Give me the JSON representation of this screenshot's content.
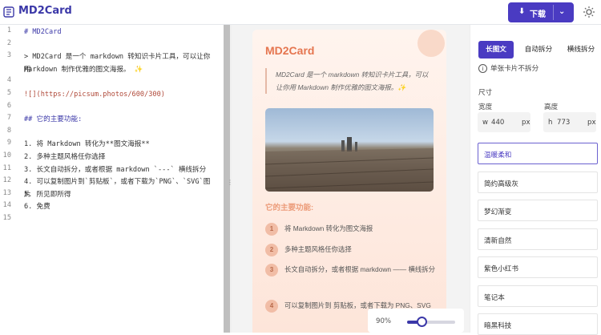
{
  "header": {
    "app_title": "MD2Card",
    "download_label": "下载",
    "logo_icon": "md-file-icon",
    "theme_icon": "sun-icon",
    "accent": "#4a3bc2"
  },
  "editor": {
    "lines": [
      {
        "n": "1",
        "text": "# MD2Card",
        "color": "#3b38a8"
      },
      {
        "n": "2",
        "text": "",
        "color": "#333"
      },
      {
        "n": "3",
        "text": "> MD2Card 是一个 markdown 转知识卡片工具，可以让你用",
        "color": "#333"
      },
      {
        "n": "",
        "text": "Markdown 制作优雅的图文海报。 ✨",
        "color": "#333"
      },
      {
        "n": "4",
        "text": "",
        "color": "#333"
      },
      {
        "n": "5",
        "text": "![](https://picsum.photos/600/300)",
        "color": "#b04a3a"
      },
      {
        "n": "6",
        "text": "",
        "color": "#333"
      },
      {
        "n": "7",
        "text": "## 它的主要功能:",
        "color": "#3b38a8"
      },
      {
        "n": "8",
        "text": "",
        "color": "#333"
      },
      {
        "n": "9",
        "text": "1. 将 Markdown 转化为**图文海报**",
        "color": "#333"
      },
      {
        "n": "10",
        "text": "2. 多种主题风格任你选择",
        "color": "#333"
      },
      {
        "n": "11",
        "text": "3. 长文自动拆分，或者根据 markdown `---` 横线拆分",
        "color": "#333"
      },
      {
        "n": "12",
        "text": "4. 可以复制图片到`剪贴板`，或者下载为`PNG`、`SVG`图片",
        "color": "#333"
      },
      {
        "n": "13",
        "text": "5. 所见即所得",
        "color": "#333"
      },
      {
        "n": "14",
        "text": "6. 免费",
        "color": "#333"
      },
      {
        "n": "15",
        "text": "",
        "color": "#333"
      }
    ]
  },
  "preview": {
    "card_title": "MD2Card",
    "quote": "MD2Card 是一个 markdown 转知识卡片工具，可以让你用 Markdown 制作优雅的图文海报。✨",
    "subheading": "它的主要功能:",
    "list": [
      {
        "num": "1",
        "text": "将 Markdown 转化为图文海报"
      },
      {
        "num": "2",
        "text": "多种主题风格任你选择"
      },
      {
        "num": "3",
        "text": "长文自动拆分，或者根据 markdown —— 横线拆分"
      },
      {
        "num": "4",
        "text": "可以复制图片到 剪贴板，或者下载为 PNG、SVG"
      }
    ]
  },
  "zoom": {
    "label": "90%",
    "fraction": 0.3
  },
  "settings": {
    "tabs": [
      "长图文",
      "自动拆分",
      "横线拆分"
    ],
    "active_tab": 0,
    "info_text": "单张卡片不拆分",
    "size_label": "尺寸",
    "width_label": "宽度",
    "height_label": "高度",
    "width_prefix": "w",
    "width_value": "440",
    "width_unit": "px",
    "height_prefix": "h",
    "height_value": "773",
    "height_unit": "px",
    "themes": [
      "温暖柔和",
      "简约高级灰",
      "梦幻渐变",
      "清新自然",
      "紫色小红书",
      "笔记本",
      "暗黑科技"
    ],
    "selected_theme": 0
  }
}
